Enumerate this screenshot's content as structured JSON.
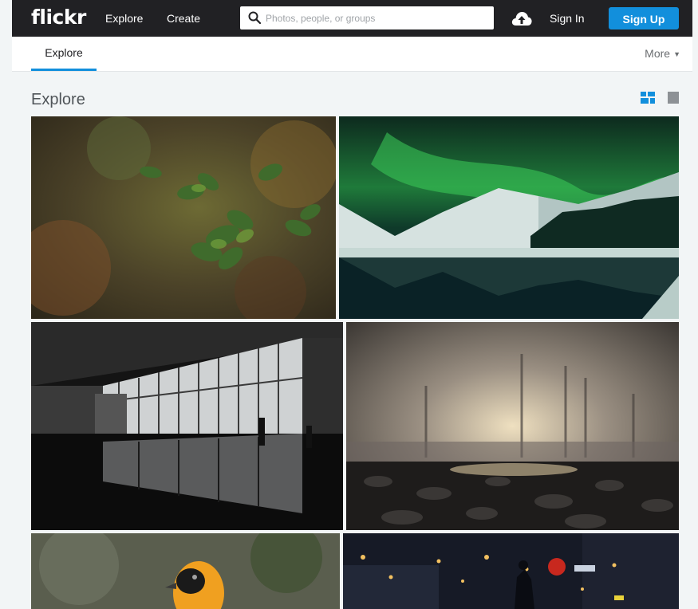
{
  "header": {
    "logo": "flickr",
    "nav": [
      "Explore",
      "Create"
    ],
    "search": {
      "placeholder": "Photos, people, or groups"
    },
    "sign_in": "Sign In",
    "sign_up": "Sign Up",
    "accent": "#128fdc"
  },
  "subnav": {
    "active_tab": "Explore",
    "more": "More"
  },
  "main": {
    "title": "Explore",
    "view_modes": [
      "justified-view-icon",
      "single-view-icon"
    ],
    "photos": [
      {
        "name": "photo-leaves"
      },
      {
        "name": "photo-aurora"
      },
      {
        "name": "photo-museum"
      },
      {
        "name": "photo-foggy-trees"
      },
      {
        "name": "photo-oriole"
      },
      {
        "name": "photo-city-night"
      }
    ]
  }
}
